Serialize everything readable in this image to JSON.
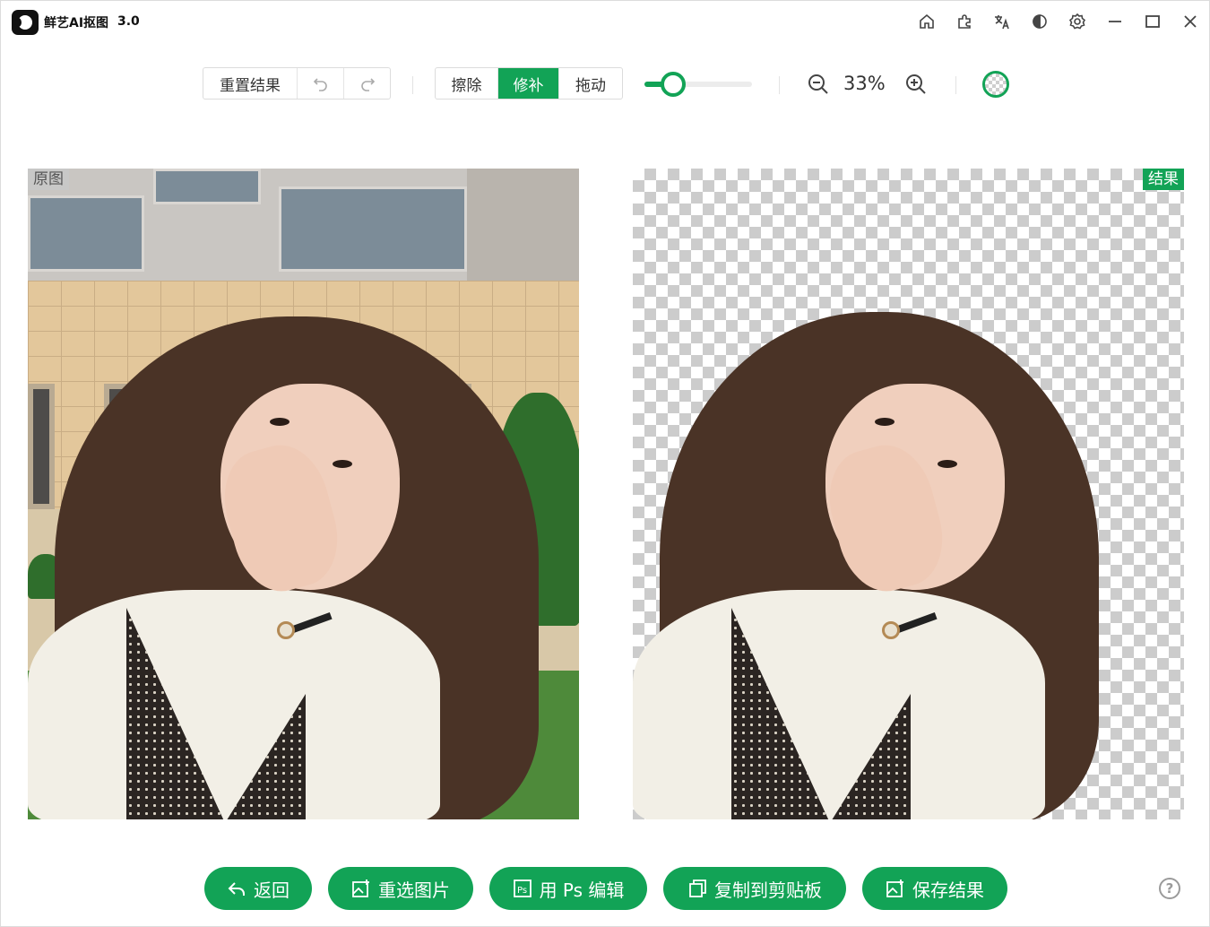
{
  "app": {
    "title": "鲜艺AI抠图",
    "version": "3.0"
  },
  "titlebar_icons": [
    "home-icon",
    "plugin-icon",
    "translate-icon",
    "theme-contrast-icon",
    "settings-icon",
    "minimize-icon",
    "maximize-icon",
    "close-icon"
  ],
  "toolbar": {
    "reset_label": "重置结果",
    "undo_icon": "undo-icon",
    "redo_icon": "redo-icon",
    "modes": [
      {
        "label": "擦除",
        "active": false
      },
      {
        "label": "修补",
        "active": true
      },
      {
        "label": "拖动",
        "active": false
      }
    ],
    "brush_size": 0.1,
    "zoom_level": "33%",
    "accent_color": "#12a356"
  },
  "panels": {
    "original_tag": "原图",
    "result_tag": "结果"
  },
  "actions": [
    {
      "label": "返回",
      "icon": "back-arrow-icon"
    },
    {
      "label": "重选图片",
      "icon": "image-add-icon"
    },
    {
      "label": "用 Ps 编辑",
      "icon": "photoshop-icon"
    },
    {
      "label": "复制到剪贴板",
      "icon": "copy-icon"
    },
    {
      "label": "保存结果",
      "icon": "image-save-icon"
    }
  ],
  "help_icon": "?"
}
